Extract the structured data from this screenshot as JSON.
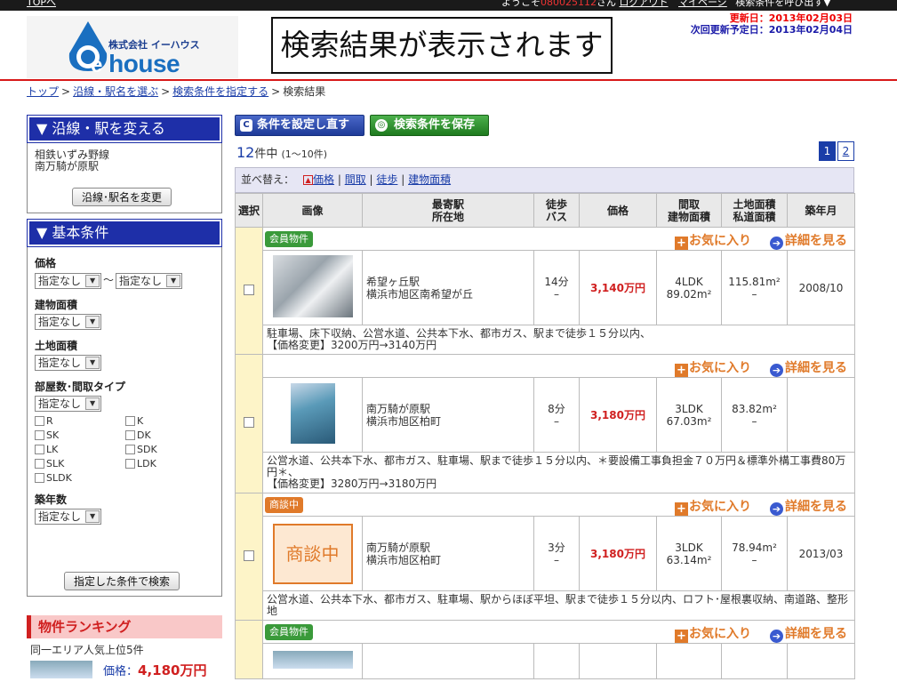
{
  "topbar": {
    "top_link": "TOPへ",
    "greeting_prefix": "ようこそ",
    "member_id": "080025112",
    "greeting_suffix": "さん",
    "logout": "ログアウト",
    "mypage": "マイページ",
    "tail": "検索条件を呼び出す▼"
  },
  "header": {
    "logo_company": "株式会社 イーハウス",
    "logo_brand_e": "e",
    "logo_brand": "house",
    "banner": "検索結果が表示されます",
    "updated": "更新日：2013年02月03日",
    "next_update": "次回更新予定日：2013年02月04日"
  },
  "breadcrumb": {
    "items": [
      "トップ",
      "沿線・駅名を選ぶ",
      "検索条件を指定する"
    ],
    "current": "検索結果"
  },
  "sidebar": {
    "station_title": "▼ 沿線・駅を変える",
    "line": "相鉄いずみ野線",
    "station": "南万騎が原駅",
    "change_button": "沿線･駅名を変更",
    "cond_title": "▼ 基本条件",
    "price_label": "価格",
    "price_min": "指定なし",
    "price_tilde": "～",
    "price_max": "指定なし",
    "building_label": "建物面積",
    "building_val": "指定なし",
    "land_label": "土地面積",
    "land_val": "指定なし",
    "rooms_label": "部屋数･間取タイプ",
    "rooms_val": "指定なし",
    "layouts": [
      "R",
      "K",
      "SK",
      "DK",
      "LK",
      "SDK",
      "SLK",
      "LDK",
      "SLDK"
    ],
    "age_label": "築年数",
    "age_val": "指定なし",
    "search_button": "指定した条件で検索",
    "arrow": "▼"
  },
  "ranking": {
    "title": "物件ランキング",
    "subtitle": "同一エリア人気上位5件",
    "price_label": "価格：",
    "price_value": "4,180万円"
  },
  "main": {
    "reset_button": "条件を設定し直す",
    "save_button": "検索条件を保存",
    "reset_icon": "C",
    "save_icon": "◎",
    "count": "12",
    "count_unit": "件中",
    "count_range": "(1〜10件)",
    "pages": [
      "1",
      "2"
    ],
    "sort_label": "並べ替え：",
    "sort_up": "▲",
    "sort_items": [
      "価格",
      "間取",
      "徒歩",
      "建物面積"
    ],
    "columns": [
      "選択",
      "画像",
      "最寄駅\n所在地",
      "徒歩\nバス",
      "価格",
      "間取\n建物面積",
      "土地面積\n私道面積",
      "築年月"
    ],
    "fav_label": "お気に入り",
    "fav_plus": "+",
    "detail_label": "詳細を見る",
    "detail_icon": "➔"
  },
  "listings": [
    {
      "tag": "会員物件",
      "station": "希望ヶ丘駅",
      "address": "横浜市旭区南希望が丘",
      "walk": "14分",
      "bus": "–",
      "price": "3,140万円",
      "layout": "4LDK",
      "building_area": "89.02m²",
      "land_area": "115.81m²",
      "private_road": "–",
      "built": "2008/10",
      "note1": "駐車場、床下収納、公営水道、公共本下水、都市ガス、駅まで徒歩１５分以内、",
      "note2": "【価格変更】3200万円→3140万円"
    },
    {
      "tag": "",
      "station": "南万騎が原駅",
      "address": "横浜市旭区柏町",
      "walk": "8分",
      "bus": "–",
      "price": "3,180万円",
      "layout": "3LDK",
      "building_area": "67.03m²",
      "land_area": "83.82m²",
      "private_road": "–",
      "built": "",
      "note1": "公営水道、公共本下水、都市ガス、駐車場、駅まで徒歩１５分以内、＊要設備工事負担金７０万円＆標準外構工事費80万円＊、",
      "note2": "【価格変更】3280万円→3180万円"
    },
    {
      "tag": "商談中",
      "image_text": "商談中",
      "station": "南万騎が原駅",
      "address": "横浜市旭区柏町",
      "walk": "3分",
      "bus": "–",
      "price": "3,180万円",
      "layout": "3LDK",
      "building_area": "63.14m²",
      "land_area": "78.94m²",
      "private_road": "–",
      "built": "2013/03",
      "note1": "公営水道、公共本下水、都市ガス、駐車場、駅からほぼ平坦、駅まで徒歩１５分以内、ロフト･屋根裏収納、南道路、整形地",
      "note2": ""
    },
    {
      "tag": "会員物件"
    }
  ]
}
